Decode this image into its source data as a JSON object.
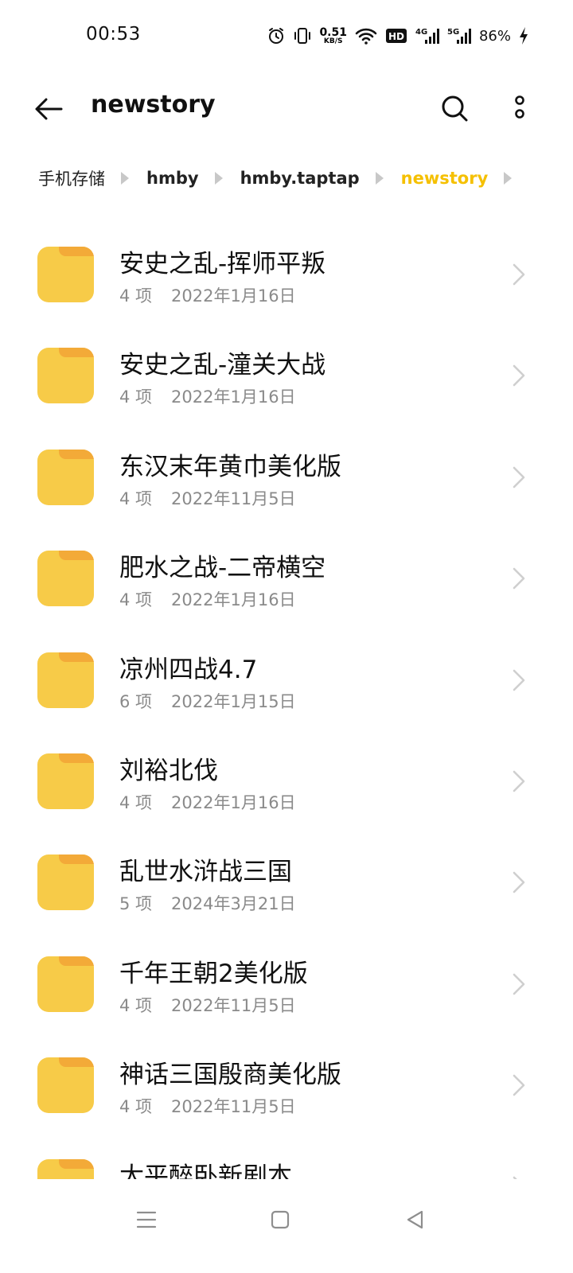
{
  "status_bar": {
    "time": "00:53",
    "net_speed_value": "0.51",
    "net_speed_unit": "KB/S",
    "hd_label": "HD",
    "sim1_label": "4G",
    "sim2_label": "5G",
    "battery_percent": "86%",
    "icons": [
      "alarm-icon",
      "vibrate-icon",
      "wifi-icon",
      "hd-voice-icon",
      "signal-4g-icon",
      "signal-5g-icon",
      "charging-icon"
    ]
  },
  "header": {
    "title": "newstory",
    "icons": [
      "back-arrow-icon",
      "search-icon",
      "more-vertical-icon"
    ]
  },
  "breadcrumb": [
    "手机存储",
    "hmby",
    "hmby.taptap",
    "newstory"
  ],
  "colors": {
    "accent": "#f5c000",
    "folder": "#f7cb48",
    "folder_tab": "#f3aa38",
    "meta_text": "#8a8a8a"
  },
  "files": [
    {
      "name": "安史之乱-挥师平叛",
      "count": "4 项",
      "date": "2022年1月16日"
    },
    {
      "name": "安史之乱-潼关大战",
      "count": "4 项",
      "date": "2022年1月16日"
    },
    {
      "name": "东汉末年黄巾美化版",
      "count": "4 项",
      "date": "2022年11月5日"
    },
    {
      "name": "肥水之战-二帝横空",
      "count": "4 项",
      "date": "2022年1月16日"
    },
    {
      "name": "凉州四战4.7",
      "count": "6 项",
      "date": "2022年1月15日"
    },
    {
      "name": "刘裕北伐",
      "count": "4 项",
      "date": "2022年1月16日"
    },
    {
      "name": "乱世水浒战三国",
      "count": "5 项",
      "date": "2024年3月21日"
    },
    {
      "name": "千年王朝2美化版",
      "count": "4 项",
      "date": "2022年11月5日"
    },
    {
      "name": "神话三国殷商美化版",
      "count": "4 项",
      "date": "2022年11月5日"
    },
    {
      "name": "太平醉卧新剧本",
      "count": "",
      "date": ""
    }
  ],
  "nav_bar": {
    "icons": [
      "menu-icon",
      "home-square-icon",
      "back-triangle-icon"
    ]
  }
}
